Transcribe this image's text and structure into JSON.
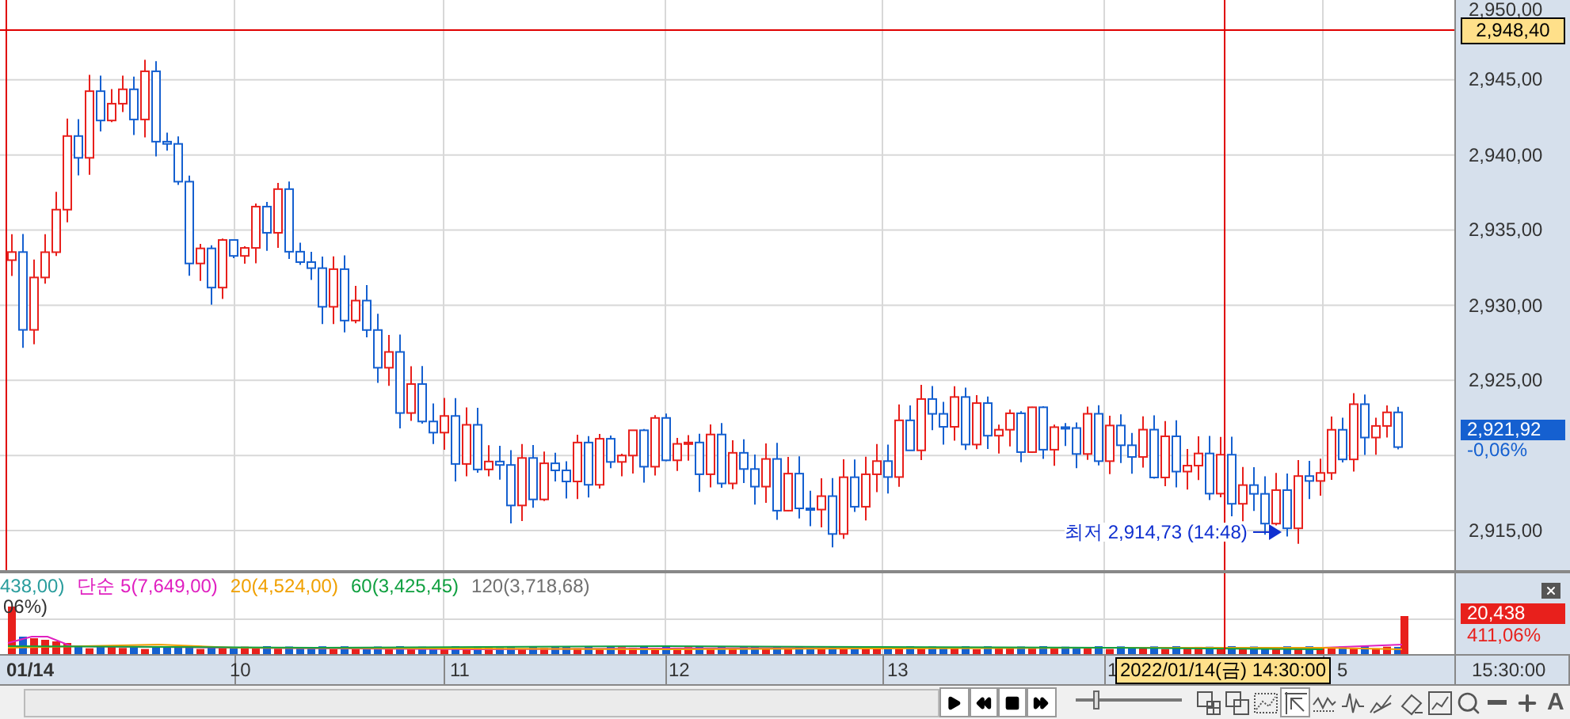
{
  "price_axis": {
    "labels": [
      "2,950,00",
      "2,945,00",
      "2,940,00",
      "2,935,00",
      "2,930,00",
      "2,925,00",
      "2,915,00"
    ],
    "crosshair_price": "2,948,40",
    "last_price": "2,921,92",
    "last_change": "-0,06%"
  },
  "low_annotation": "최저 2,914,73 (14:48)",
  "volume_legend": [
    {
      "text": "438,00)",
      "color": "#2a9d9d"
    },
    {
      "text": "단순 5(7,649,00)",
      "color": "#e020c0"
    },
    {
      "text": "20(4,524,00)",
      "color": "#f0a000"
    },
    {
      "text": "60(3,425,45)",
      "color": "#10a040"
    },
    {
      "text": "120(3,718,68)",
      "color": "#707070"
    }
  ],
  "volume_sub": "06%)",
  "volume_axis": {
    "last_volume": "20,438",
    "ratio": "411,06%"
  },
  "time_axis": {
    "labels": [
      "01/14",
      "10",
      "11",
      "12",
      "13",
      "1",
      "5"
    ],
    "end_time": "15:30:00",
    "crosshair_time": "2022/01/14(금) 14:30:00"
  },
  "toolbar": {
    "playback": [
      {
        "kind": "play"
      },
      {
        "kind": "rewind"
      },
      {
        "kind": "stop"
      },
      {
        "kind": "fast-forward"
      }
    ],
    "speed": {
      "level": 0.18
    },
    "tools": [
      {
        "kind": "window-grid",
        "selected": false
      },
      {
        "kind": "window-overlap",
        "selected": false
      },
      {
        "kind": "dotted-chart",
        "selected": false
      },
      {
        "kind": "pointer",
        "selected": true
      },
      {
        "kind": "wave",
        "selected": false
      },
      {
        "kind": "spike",
        "selected": false
      },
      {
        "kind": "trend",
        "selected": false
      },
      {
        "kind": "eraser",
        "selected": false
      },
      {
        "kind": "chart-window",
        "selected": false
      },
      {
        "kind": "zoom",
        "selected": false
      },
      {
        "kind": "minus",
        "selected": false
      },
      {
        "kind": "plus",
        "selected": false
      },
      {
        "kind": "text",
        "label": "A",
        "selected": false
      }
    ]
  }
}
